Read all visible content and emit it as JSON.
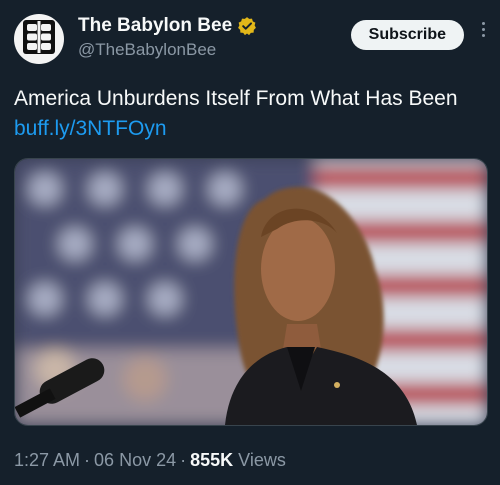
{
  "author": {
    "display_name": "The Babylon Bee",
    "handle": "@TheBabylonBee",
    "avatar_icon": "babylon-bee-logo-icon",
    "verified_icon": "verified-gold-badge-icon",
    "verified_color": "#e2b719"
  },
  "actions": {
    "subscribe_label": "Subscribe",
    "more_icon": "more-vertical-icon"
  },
  "post": {
    "text": "America Unburdens Itself From What Has Been",
    "link_text": "buff.ly/3NTFOyn",
    "link_color": "#1d9bf0",
    "media_description_icon": "photo-icon"
  },
  "meta": {
    "time": "1:27 AM",
    "separator": "·",
    "date": "06 Nov 24",
    "views_count": "855K",
    "views_label": "Views"
  },
  "colors": {
    "background": "#15202b",
    "text_primary": "#f7f9f9",
    "text_secondary": "#8b98a5"
  }
}
